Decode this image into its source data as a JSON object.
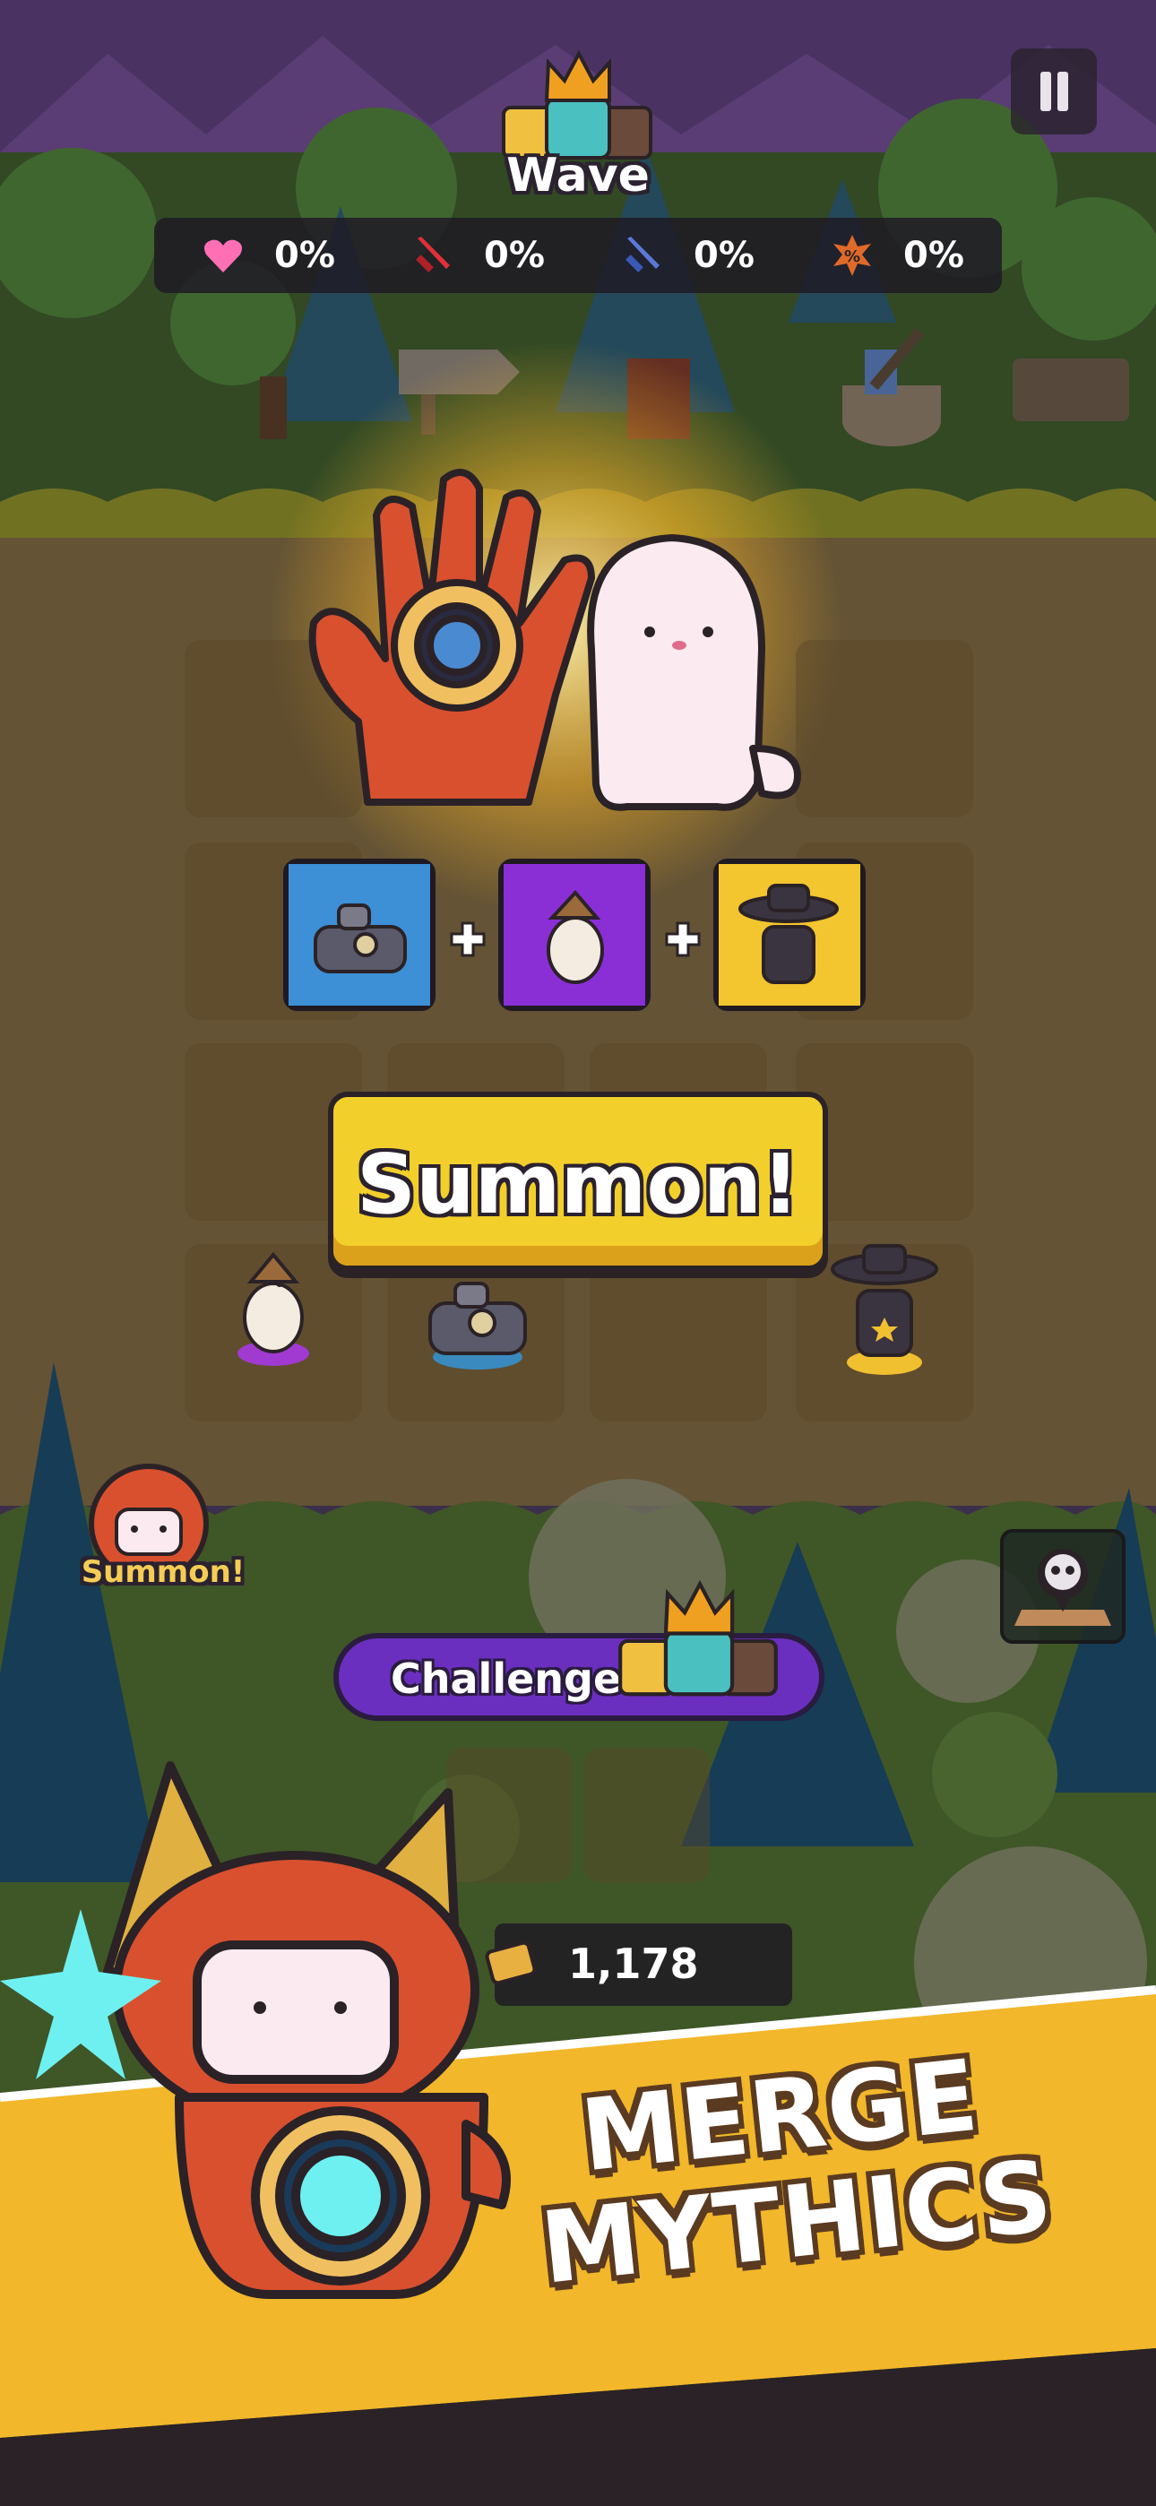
{
  "hud": {
    "wave_label": "Wave",
    "stats": [
      {
        "icon": "heart-icon",
        "value": "0%",
        "color": "#ff6fb4"
      },
      {
        "icon": "sword-icon",
        "value": "0%",
        "color": "#e0303a"
      },
      {
        "icon": "blue-sword-icon",
        "value": "0%",
        "color": "#5b78d8"
      },
      {
        "icon": "percent-burst-icon",
        "value": "0%",
        "color": "#e06a28"
      }
    ],
    "pause_icon": "pause-icon"
  },
  "summon_panel": {
    "recipe_tiles": [
      {
        "unit": "robot-tank-unit",
        "color": "#3d8fd6"
      },
      {
        "unit": "eagle-warrior-unit",
        "color": "#8a2fd6"
      },
      {
        "unit": "cowboy-bandit-unit",
        "color": "#f3c52e"
      }
    ],
    "summon_button_label": "Summon!"
  },
  "side_summon_label": "Summon!",
  "challenge_button_label": "Challenge",
  "gold_amount": "1,178",
  "banner": {
    "line1": "MERGE",
    "line2": "MYTHICS",
    "color": "#f2b72a"
  }
}
